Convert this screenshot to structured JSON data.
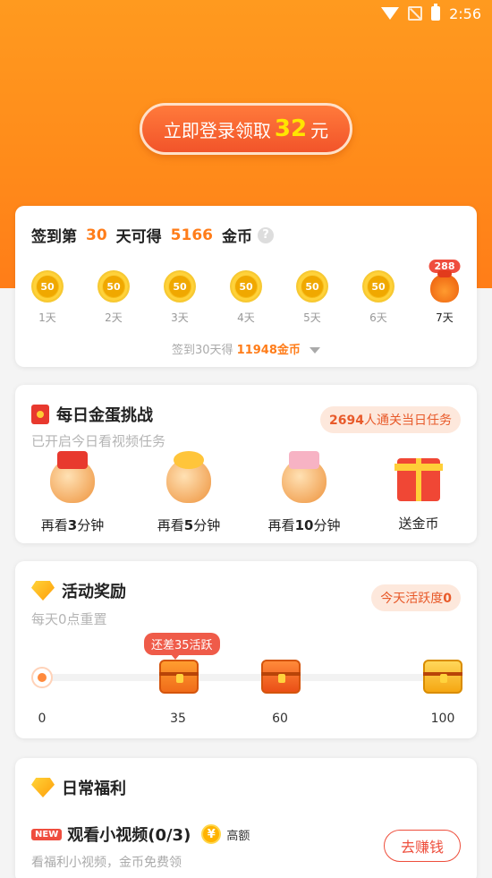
{
  "status": {
    "time": "2:56"
  },
  "login": {
    "prefix": "立即登录领取",
    "amount": "32",
    "suffix": "元"
  },
  "signin": {
    "title_a": "签到第",
    "day": "30",
    "title_b": "天可得",
    "coins": "5166",
    "title_c": "金币",
    "help": "?",
    "days": [
      {
        "label": "1天",
        "coin": "50"
      },
      {
        "label": "2天",
        "coin": "50"
      },
      {
        "label": "3天",
        "coin": "50"
      },
      {
        "label": "4天",
        "coin": "50"
      },
      {
        "label": "5天",
        "coin": "50"
      },
      {
        "label": "6天",
        "coin": "50"
      },
      {
        "label": "7天",
        "badge": "288"
      }
    ],
    "foot_a": "签到30天得",
    "foot_b": "11948金币"
  },
  "egg": {
    "title": "每日金蛋挑战",
    "sub": "已开启今日看视频任务",
    "pill_num": "2694",
    "pill_text": "人通关当日任务",
    "tasks": [
      {
        "pre": "再看",
        "num": "3",
        "post": "分钟"
      },
      {
        "pre": "再看",
        "num": "5",
        "post": "分钟"
      },
      {
        "pre": "再看",
        "num": "10",
        "post": "分钟"
      },
      {
        "label": "送金币"
      }
    ]
  },
  "activity": {
    "title": "活动奖励",
    "sub": "每天0点重置",
    "pill_text": "今天活跃度",
    "pill_num": "0",
    "tooltip": "还差35活跃",
    "ticks": [
      "0",
      "35",
      "60",
      "100"
    ]
  },
  "welfare": {
    "title": "日常福利",
    "new": "NEW",
    "task_title": "观看小视频(0/3)",
    "yuan": "¥",
    "high": "高额",
    "desc": "看福利小视频，金币免费领",
    "button": "去赚钱"
  }
}
